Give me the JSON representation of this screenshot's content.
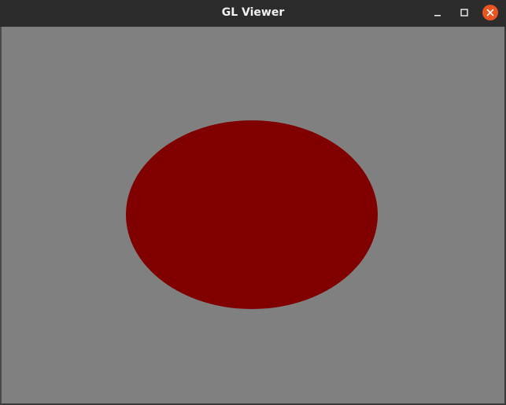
{
  "window": {
    "title": "GL Viewer",
    "controls": {
      "minimize_icon": "minimize-icon",
      "maximize_icon": "maximize-icon",
      "close_icon": "close-icon"
    }
  },
  "viewport": {
    "background_color": "#808080",
    "shape": "ellipse",
    "shape_color": "#800000"
  },
  "colors": {
    "titlebar": "#2c2c2c",
    "close_button": "#e95420"
  }
}
